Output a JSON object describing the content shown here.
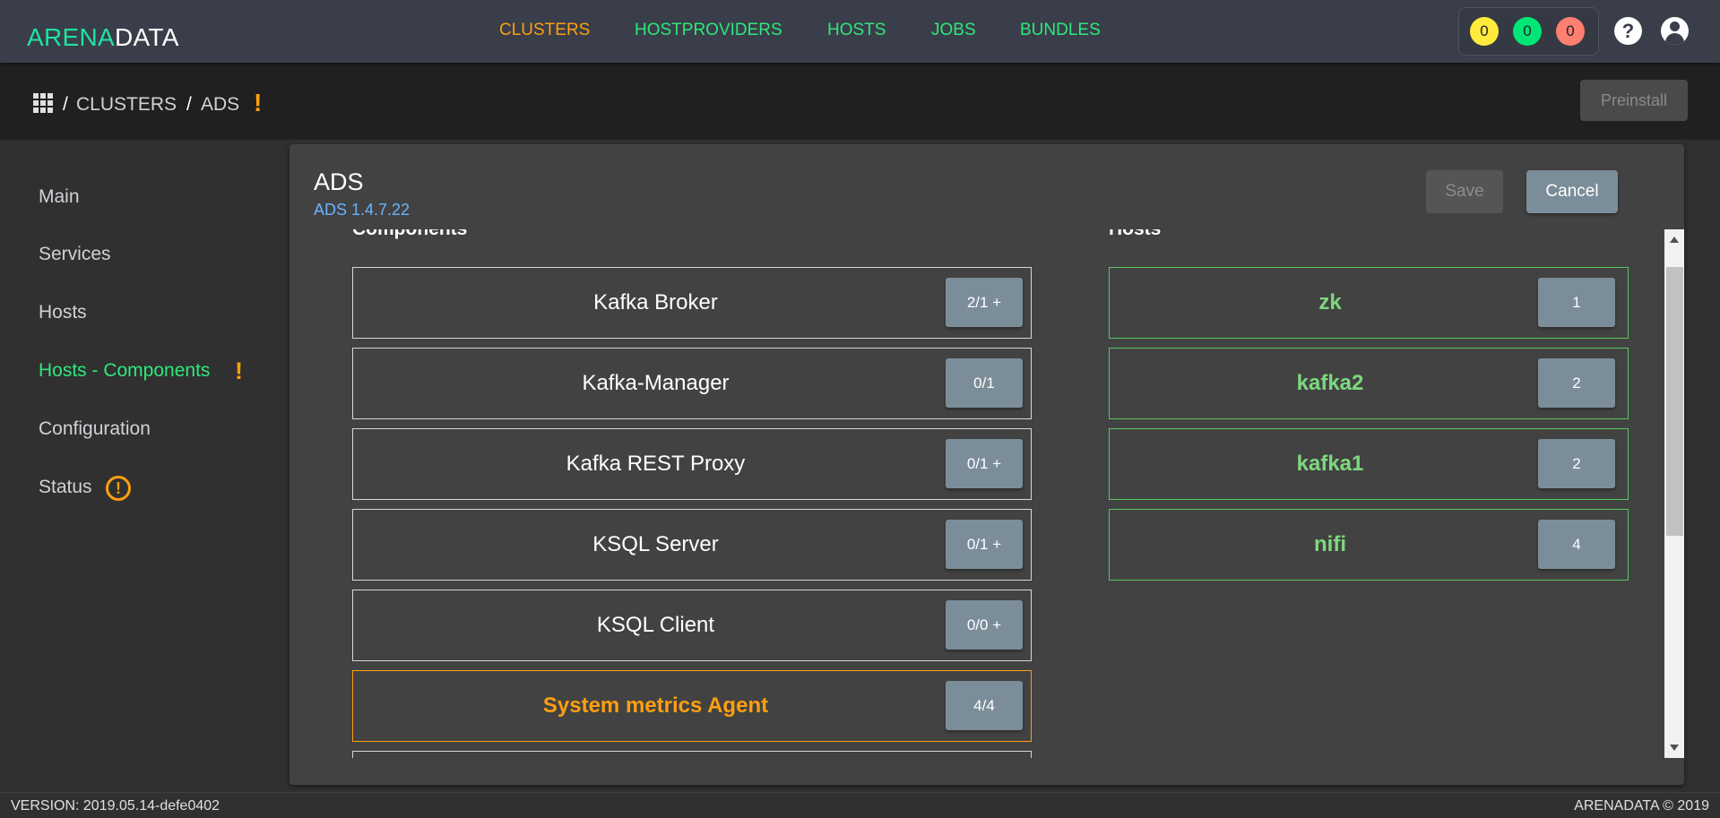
{
  "brand": {
    "logo_part1": "ARENA",
    "logo_part2": "DATA"
  },
  "nav": {
    "items": [
      {
        "label": "CLUSTERS",
        "active": true
      },
      {
        "label": "HOSTPROVIDERS",
        "active": false
      },
      {
        "label": "HOSTS",
        "active": false
      },
      {
        "label": "JOBS",
        "active": false
      },
      {
        "label": "BUNDLES",
        "active": false
      }
    ]
  },
  "counters": [
    {
      "value": "0",
      "color": "#ffeb3b"
    },
    {
      "value": "0",
      "color": "#00e676"
    },
    {
      "value": "0",
      "color": "#ff7f70"
    }
  ],
  "header_icons": {
    "help": "help-icon",
    "account": "account-icon",
    "help_glyph": "?"
  },
  "breadcrumb": {
    "apps_icon": "apps-grid-icon",
    "separator": "/",
    "items": [
      "CLUSTERS",
      "ADS"
    ],
    "warning_glyph": "!"
  },
  "actions": {
    "preinstall": "Preinstall"
  },
  "sidebar": {
    "items": [
      {
        "label": "Main",
        "active": false
      },
      {
        "label": "Services",
        "active": false
      },
      {
        "label": "Hosts",
        "active": false
      },
      {
        "label": "Hosts - Components",
        "active": true,
        "warning": "!"
      },
      {
        "label": "Configuration",
        "active": false
      },
      {
        "label": "Status",
        "active": false,
        "status_glyph": "!"
      }
    ]
  },
  "card": {
    "title": "ADS",
    "subtitle": "ADS 1.4.7.22",
    "save_label": "Save",
    "cancel_label": "Cancel",
    "components_heading": "Components",
    "hosts_heading": "Hosts"
  },
  "components": [
    {
      "name": "Kafka Broker",
      "count": "2/1 +",
      "warning": false
    },
    {
      "name": "Kafka-Manager",
      "count": "0/1",
      "warning": false
    },
    {
      "name": "Kafka REST Proxy",
      "count": "0/1 +",
      "warning": false
    },
    {
      "name": "KSQL Server",
      "count": "0/1 +",
      "warning": false
    },
    {
      "name": "KSQL Client",
      "count": "0/0 +",
      "warning": false
    },
    {
      "name": "System metrics Agent",
      "count": "4/4",
      "warning": true
    }
  ],
  "hosts": [
    {
      "name": "zk",
      "count": "1"
    },
    {
      "name": "kafka2",
      "count": "2"
    },
    {
      "name": "kafka1",
      "count": "2"
    },
    {
      "name": "nifi",
      "count": "4"
    }
  ],
  "footer": {
    "version": "VERSION: 2019.05.14-defe0402",
    "copyright": "ARENADATA © 2019"
  }
}
